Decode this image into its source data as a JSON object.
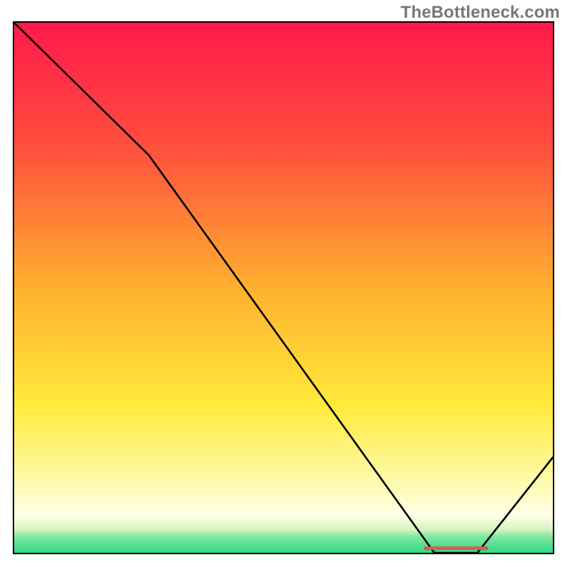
{
  "watermark": "TheBottleneck.com",
  "chart_data": {
    "type": "line",
    "title": "",
    "xlabel": "",
    "ylabel": "",
    "xlim": [
      0,
      100
    ],
    "ylim": [
      0,
      100
    ],
    "x": [
      0,
      25,
      78,
      86,
      100
    ],
    "values": [
      100,
      75,
      0,
      0,
      18
    ],
    "series": [
      {
        "name": "bottleneck-curve",
        "x": [
          0,
          25,
          78,
          86,
          100
        ],
        "values": [
          100,
          75,
          0,
          0,
          18
        ]
      }
    ],
    "gradient_stops": [
      {
        "pct": 0,
        "color": "#ff1a4b"
      },
      {
        "pct": 22,
        "color": "#ff4a3e"
      },
      {
        "pct": 50,
        "color": "#ffb030"
      },
      {
        "pct": 72,
        "color": "#ffe93a"
      },
      {
        "pct": 87,
        "color": "#fffbb0"
      },
      {
        "pct": 93,
        "color": "#ffffe8"
      },
      {
        "pct": 95.5,
        "color": "#d9f4c0"
      },
      {
        "pct": 97,
        "color": "#7fe8a0"
      },
      {
        "pct": 100,
        "color": "#2fd883"
      }
    ],
    "marker": {
      "x_start": 76,
      "x_end": 88,
      "y": 0.6,
      "color": "#d85a56"
    }
  }
}
